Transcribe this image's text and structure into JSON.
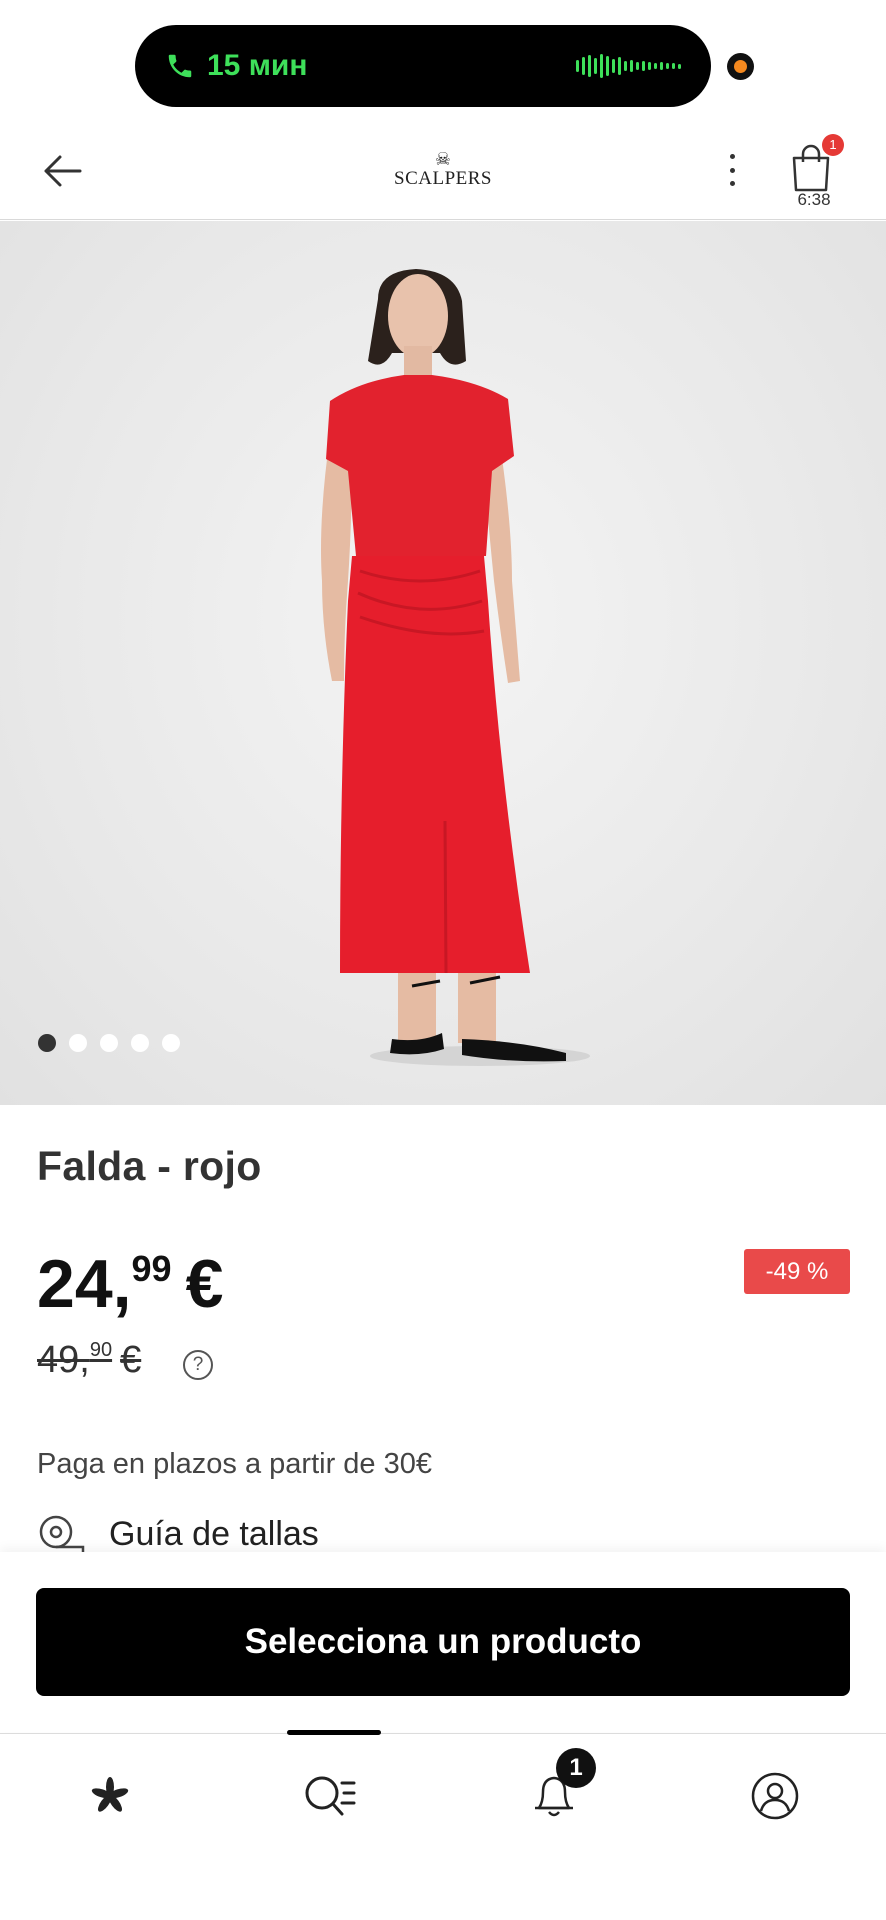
{
  "status": {
    "call_duration": "15 мин",
    "call_color": "#3ee05a",
    "recording_indicator_color": "#f5891f"
  },
  "header": {
    "back_icon": "arrow-left-icon",
    "brand": "SCALPERS",
    "brand_icon": "skull-icon",
    "more_icon": "vertical-dots-icon",
    "cart_icon": "shopping-bag-icon",
    "cart_count": "1",
    "cart_time": "6:38"
  },
  "gallery": {
    "image_description": "model wearing red top and red midi skirt",
    "dot_count": 5,
    "active_dot": 0
  },
  "product": {
    "title": "Falda - rojo",
    "price_int": "24,",
    "price_cents": "99",
    "price_currency": "€",
    "old_price_int": "49,",
    "old_price_cents": "90",
    "old_price_currency": "€",
    "help_symbol": "?",
    "discount": "-49 %",
    "discount_color": "#e94a4a",
    "installments_text": "Paga en plazos a partir de 30€",
    "size_guide_label": "Guía de tallas"
  },
  "cta": {
    "label": "Selecciona un producto"
  },
  "bottom_nav": {
    "items": [
      {
        "icon": "flower-logo-icon"
      },
      {
        "icon": "search-list-icon",
        "active": true
      },
      {
        "icon": "bell-icon",
        "badge": "1"
      },
      {
        "icon": "user-profile-icon"
      }
    ]
  }
}
